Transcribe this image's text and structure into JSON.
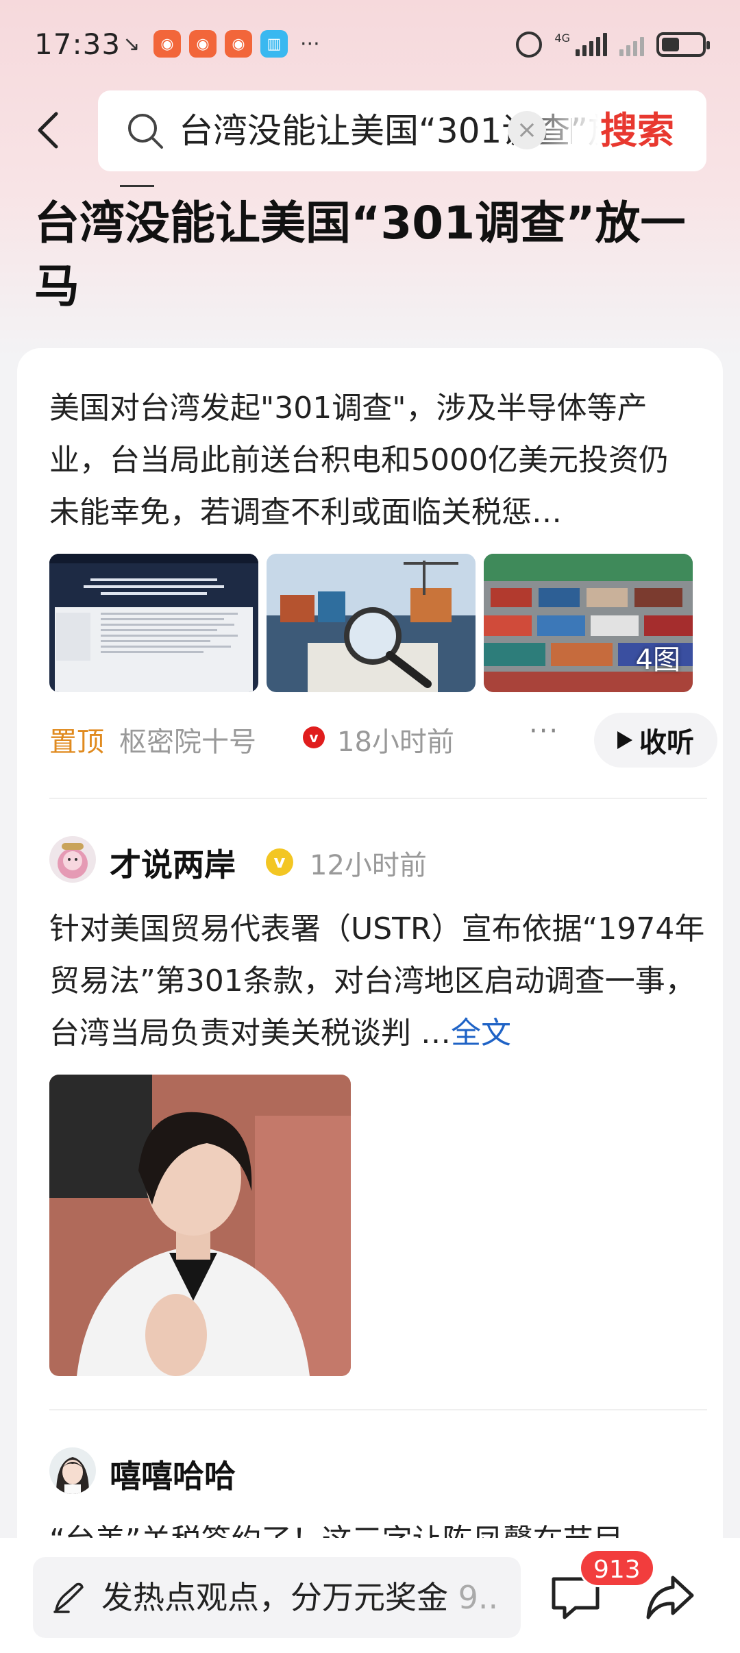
{
  "status_bar": {
    "time": "17:33",
    "network_label": "4G",
    "app_icons": [
      "missed-call-icon",
      "app-icon",
      "app-icon",
      "app-icon",
      "reader-icon"
    ],
    "battery_level": 0.45
  },
  "header": {
    "search_query": "台湾没能让美国“301调查”放一马",
    "clear_symbol": "×",
    "search_button": "搜索"
  },
  "page_title": "台湾没能让美国“301调查”放一马",
  "summary": {
    "text": "美国对台湾发起\"301调查\"，涉及半导体等产业，台当局此前送台积电和5000亿美元投资仍未能幸免，若调查不利或面临关税惩…",
    "image_count": "4图",
    "pin_tag": "置顶",
    "source": "枢密院十号",
    "verified_mark": "v",
    "time_ago": "18小时前",
    "more": "···",
    "listen_button": "收听"
  },
  "post1": {
    "author": "才说两岸",
    "verified_mark": "v",
    "time_ago": "12小时前",
    "text": "针对美国贸易代表署（USTR）宣布依据“1974年贸易法”第301条款，对台湾地区启动调查一事，台湾当局负责对美关税谈判 …",
    "full_text_link": "全文"
  },
  "post2": {
    "author": "嘻嘻哈哈",
    "text_partial": "“台美”关税签约了！这三字让陈凤馨在节目"
  },
  "bottom_bar": {
    "comment_placeholder": "发热点观点，分万元奖金",
    "comment_placeholder_tail": "9..",
    "comment_count": "913"
  },
  "colors": {
    "accent_red": "#e8382f",
    "pin_orange": "#e08a1e",
    "link_blue": "#1f63c6",
    "badge_red": "#f23d3d",
    "verified_gold": "#f3c623"
  }
}
